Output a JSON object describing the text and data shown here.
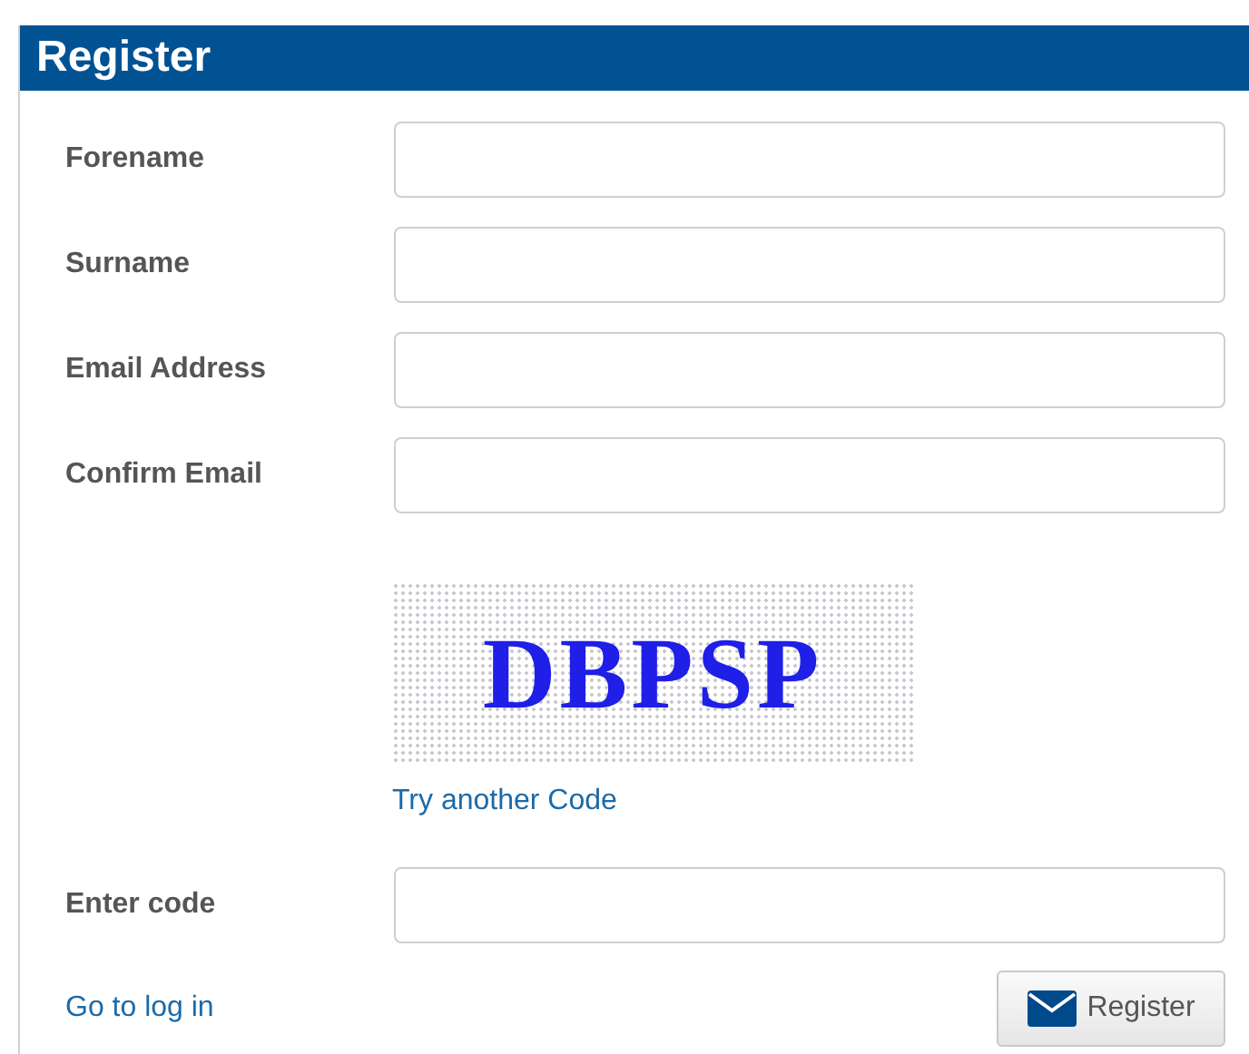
{
  "panel": {
    "title": "Register"
  },
  "fields": [
    {
      "label": "Forename"
    },
    {
      "label": "Surname"
    },
    {
      "label": "Email Address"
    },
    {
      "label": "Confirm Email"
    }
  ],
  "captcha": {
    "code": "DBPSP",
    "refresh_link": "Try another Code"
  },
  "code_field": {
    "label": "Enter code"
  },
  "login_link": "Go to log in",
  "submit_button": "Register"
}
